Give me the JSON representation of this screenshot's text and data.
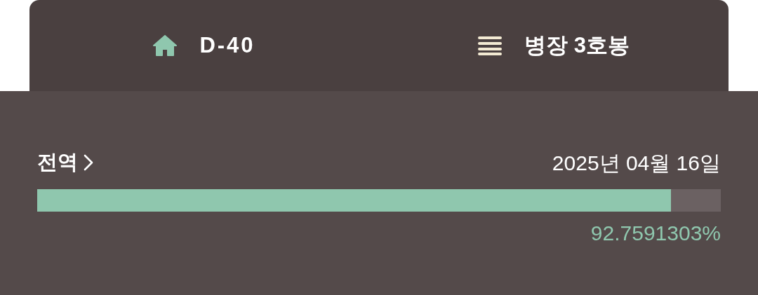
{
  "header": {
    "items": [
      {
        "kind": "home",
        "label": "D-40"
      },
      {
        "kind": "menu",
        "label": "병장 3호봉"
      }
    ]
  },
  "discharge": {
    "title": "전역",
    "date": "2025년 04월 16일",
    "level": 0.927591303,
    "percent": "92.7591303%"
  }
}
